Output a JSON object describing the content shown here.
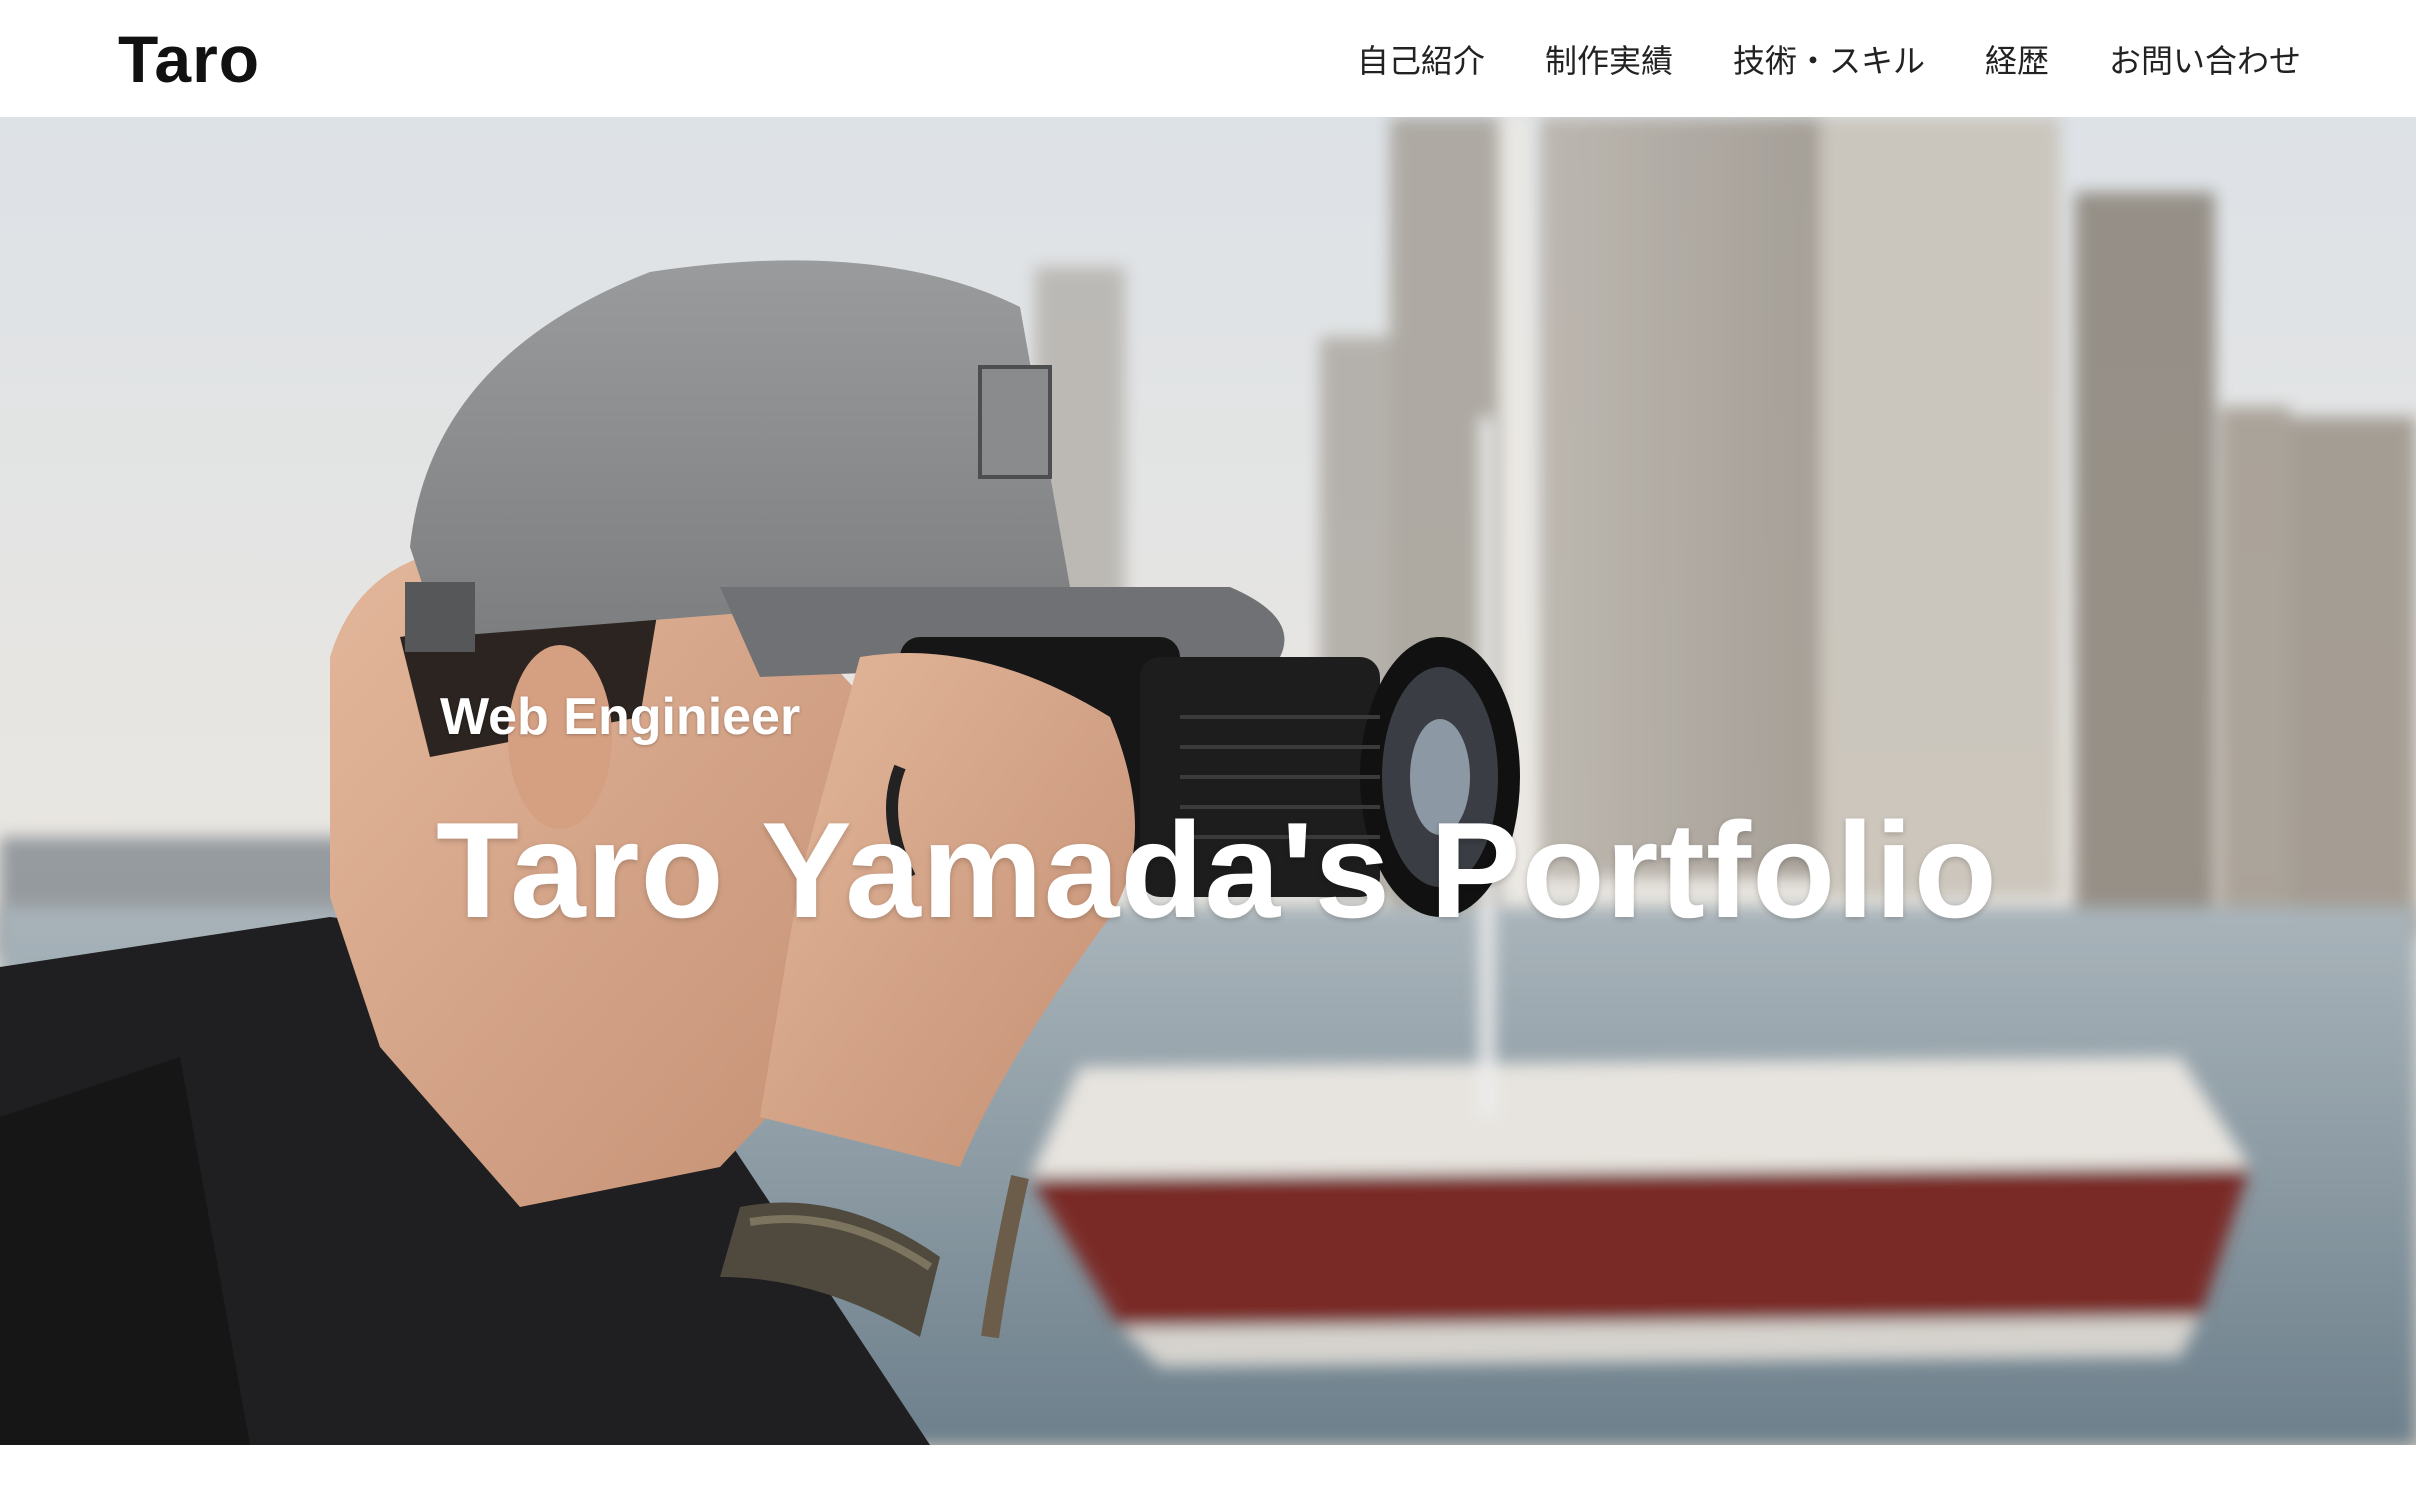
{
  "header": {
    "logo": "Taro",
    "nav": [
      {
        "label": "自己紹介"
      },
      {
        "label": "制作実績"
      },
      {
        "label": "技術・スキル"
      },
      {
        "label": "経歴"
      },
      {
        "label": "お問い合わせ"
      }
    ]
  },
  "hero": {
    "subtitle": "Web Enginieer",
    "title": "Taro Yamada's Portfolio",
    "image_description_icon": "photographer-photo"
  },
  "colors": {
    "header_bg": "#ffffff",
    "logo_text": "#111111",
    "nav_text": "#222222",
    "hero_text": "#ffffff"
  }
}
